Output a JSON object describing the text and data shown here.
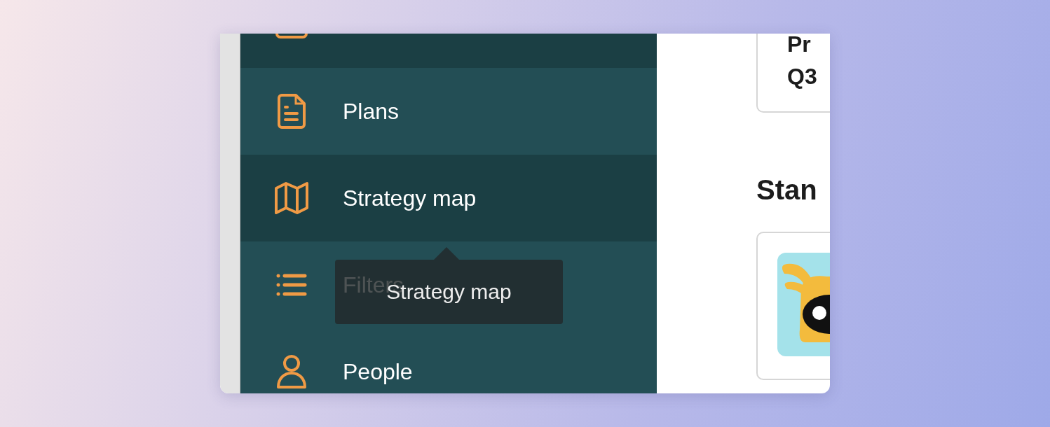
{
  "sidebar": {
    "items": [
      {
        "selected": true
      },
      {
        "label": "Plans",
        "selected": false
      },
      {
        "label": "Strategy map",
        "selected": true
      },
      {
        "label": "Filters",
        "selected": false
      },
      {
        "label": "People",
        "selected": false
      }
    ]
  },
  "tooltip": {
    "text": "Strategy map"
  },
  "content": {
    "card": {
      "lines": [
        "Pr",
        "Q3"
      ]
    },
    "heading": "Stan"
  }
}
